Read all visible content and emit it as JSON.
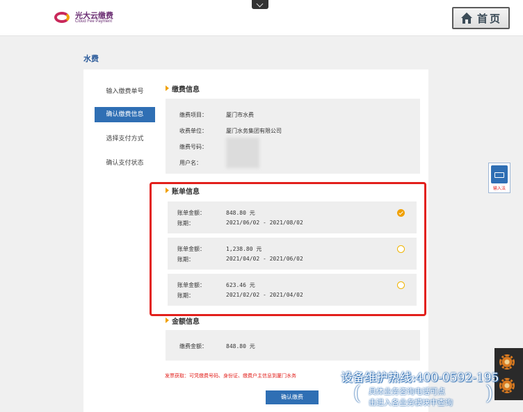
{
  "header": {
    "logo_cn": "光大云缴费",
    "logo_en": "Cloud Fee Payment",
    "home_label": "首页"
  },
  "page": {
    "title": "水费"
  },
  "steps": [
    {
      "label": "输入缴费单号",
      "active": false
    },
    {
      "label": "确认缴费信息",
      "active": true
    },
    {
      "label": "选择支付方式",
      "active": false
    },
    {
      "label": "确认支付状态",
      "active": false
    }
  ],
  "payment_info": {
    "title": "缴费信息",
    "item_label": "缴费项目：",
    "item_value": "厦门市水费",
    "payee_label": "收费单位：",
    "payee_value": "厦门水务集团有限公司",
    "number_label": "缴费号码：",
    "holder_label": "用户名："
  },
  "bill_info": {
    "title": "账单信息",
    "bills": [
      {
        "amount_label": "账单金额：",
        "amount": "848.80 元",
        "period_label": "账期：",
        "period": "2021/06/02 - 2021/08/02",
        "selected": true
      },
      {
        "amount_label": "账单金额：",
        "amount": "1,238.80 元",
        "period_label": "账期：",
        "period": "2021/04/02 - 2021/06/02",
        "selected": false
      },
      {
        "amount_label": "账单金额：",
        "amount": "623.46 元",
        "period_label": "账期：",
        "period": "2021/02/02 - 2021/04/02",
        "selected": false
      }
    ]
  },
  "amount_info": {
    "title": "金额信息",
    "label": "缴费金额：",
    "value": "848.80  元"
  },
  "notice": "发票获取：可凭缴费号码、身份证、缴费户主信息到厦门水务",
  "confirm_label": "确认缴费",
  "keyboard": {
    "label": "输入法"
  },
  "overlay": {
    "hotline": "设备维护热线:400-0592-195",
    "note_line1": "具体业务咨询电话可点",
    "note_line2": "击进入各业务模块中查询",
    "paren_open": "(",
    "paren_close": ")"
  },
  "colors": {
    "brand_blue": "#2f6fb4",
    "accent_orange": "#f0a000",
    "highlight_red": "#e2201c"
  },
  "icons": [
    "home-icon",
    "chevron-down-icon",
    "keyboard-icon",
    "check-icon",
    "gear-icon"
  ]
}
